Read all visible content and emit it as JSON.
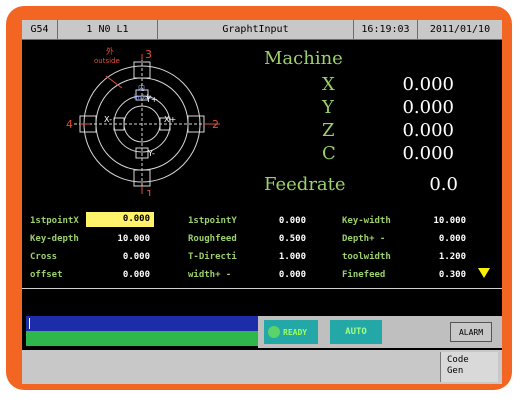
{
  "header": {
    "coord": "G54",
    "mode": "1 N0 L1",
    "title": "GraphtInput",
    "time": "16:19:03",
    "date": "2011/01/10"
  },
  "diagram": {
    "label_top": "外",
    "label_outside": "outside",
    "label_inside_cn": "内",
    "label_inside": "inside",
    "num_top": "3",
    "num_left": "4",
    "num_right": "2",
    "num_bottom": "1",
    "x_minus": "X-",
    "x_plus": "X+",
    "y_plus": "Y+",
    "y_minus": "Y-"
  },
  "machine": {
    "title": "Machine",
    "axes": [
      {
        "name": "X",
        "value": "0.000"
      },
      {
        "name": "Y",
        "value": "0.000"
      },
      {
        "name": "Z",
        "value": "0.000"
      },
      {
        "name": "C",
        "value": "0.000"
      }
    ],
    "feedrate_label": "Feedrate",
    "feedrate_value": "0.0"
  },
  "params": {
    "col1": [
      {
        "label": "1stpointX",
        "value": "0.000"
      },
      {
        "label": "Key-depth",
        "value": "10.000"
      },
      {
        "label": "Cross",
        "value": "0.000"
      },
      {
        "label": "offset",
        "value": "0.000"
      }
    ],
    "col2": [
      {
        "label": "1stpointY",
        "value": "0.000"
      },
      {
        "label": "Roughfeed",
        "value": "0.500"
      },
      {
        "label": "T-Directi",
        "value": "1.000"
      },
      {
        "label": "width+ -",
        "value": "0.000"
      }
    ],
    "col3": [
      {
        "label": "Key-width",
        "value": "10.000"
      },
      {
        "label": "Depth+ -",
        "value": "0.000"
      },
      {
        "label": "toolwidth",
        "value": "1.200"
      },
      {
        "label": "Finefeed",
        "value": "0.300"
      }
    ]
  },
  "status": {
    "ready": "READY",
    "auto": "AUTO",
    "alarm": "ALARM"
  },
  "softkey": {
    "line1": "Code",
    "line2": "Gen"
  },
  "colors": {
    "frame": "#f26522",
    "text_green": "#9bd06a",
    "highlight": "#fff36b",
    "arrow": "#fff000"
  }
}
